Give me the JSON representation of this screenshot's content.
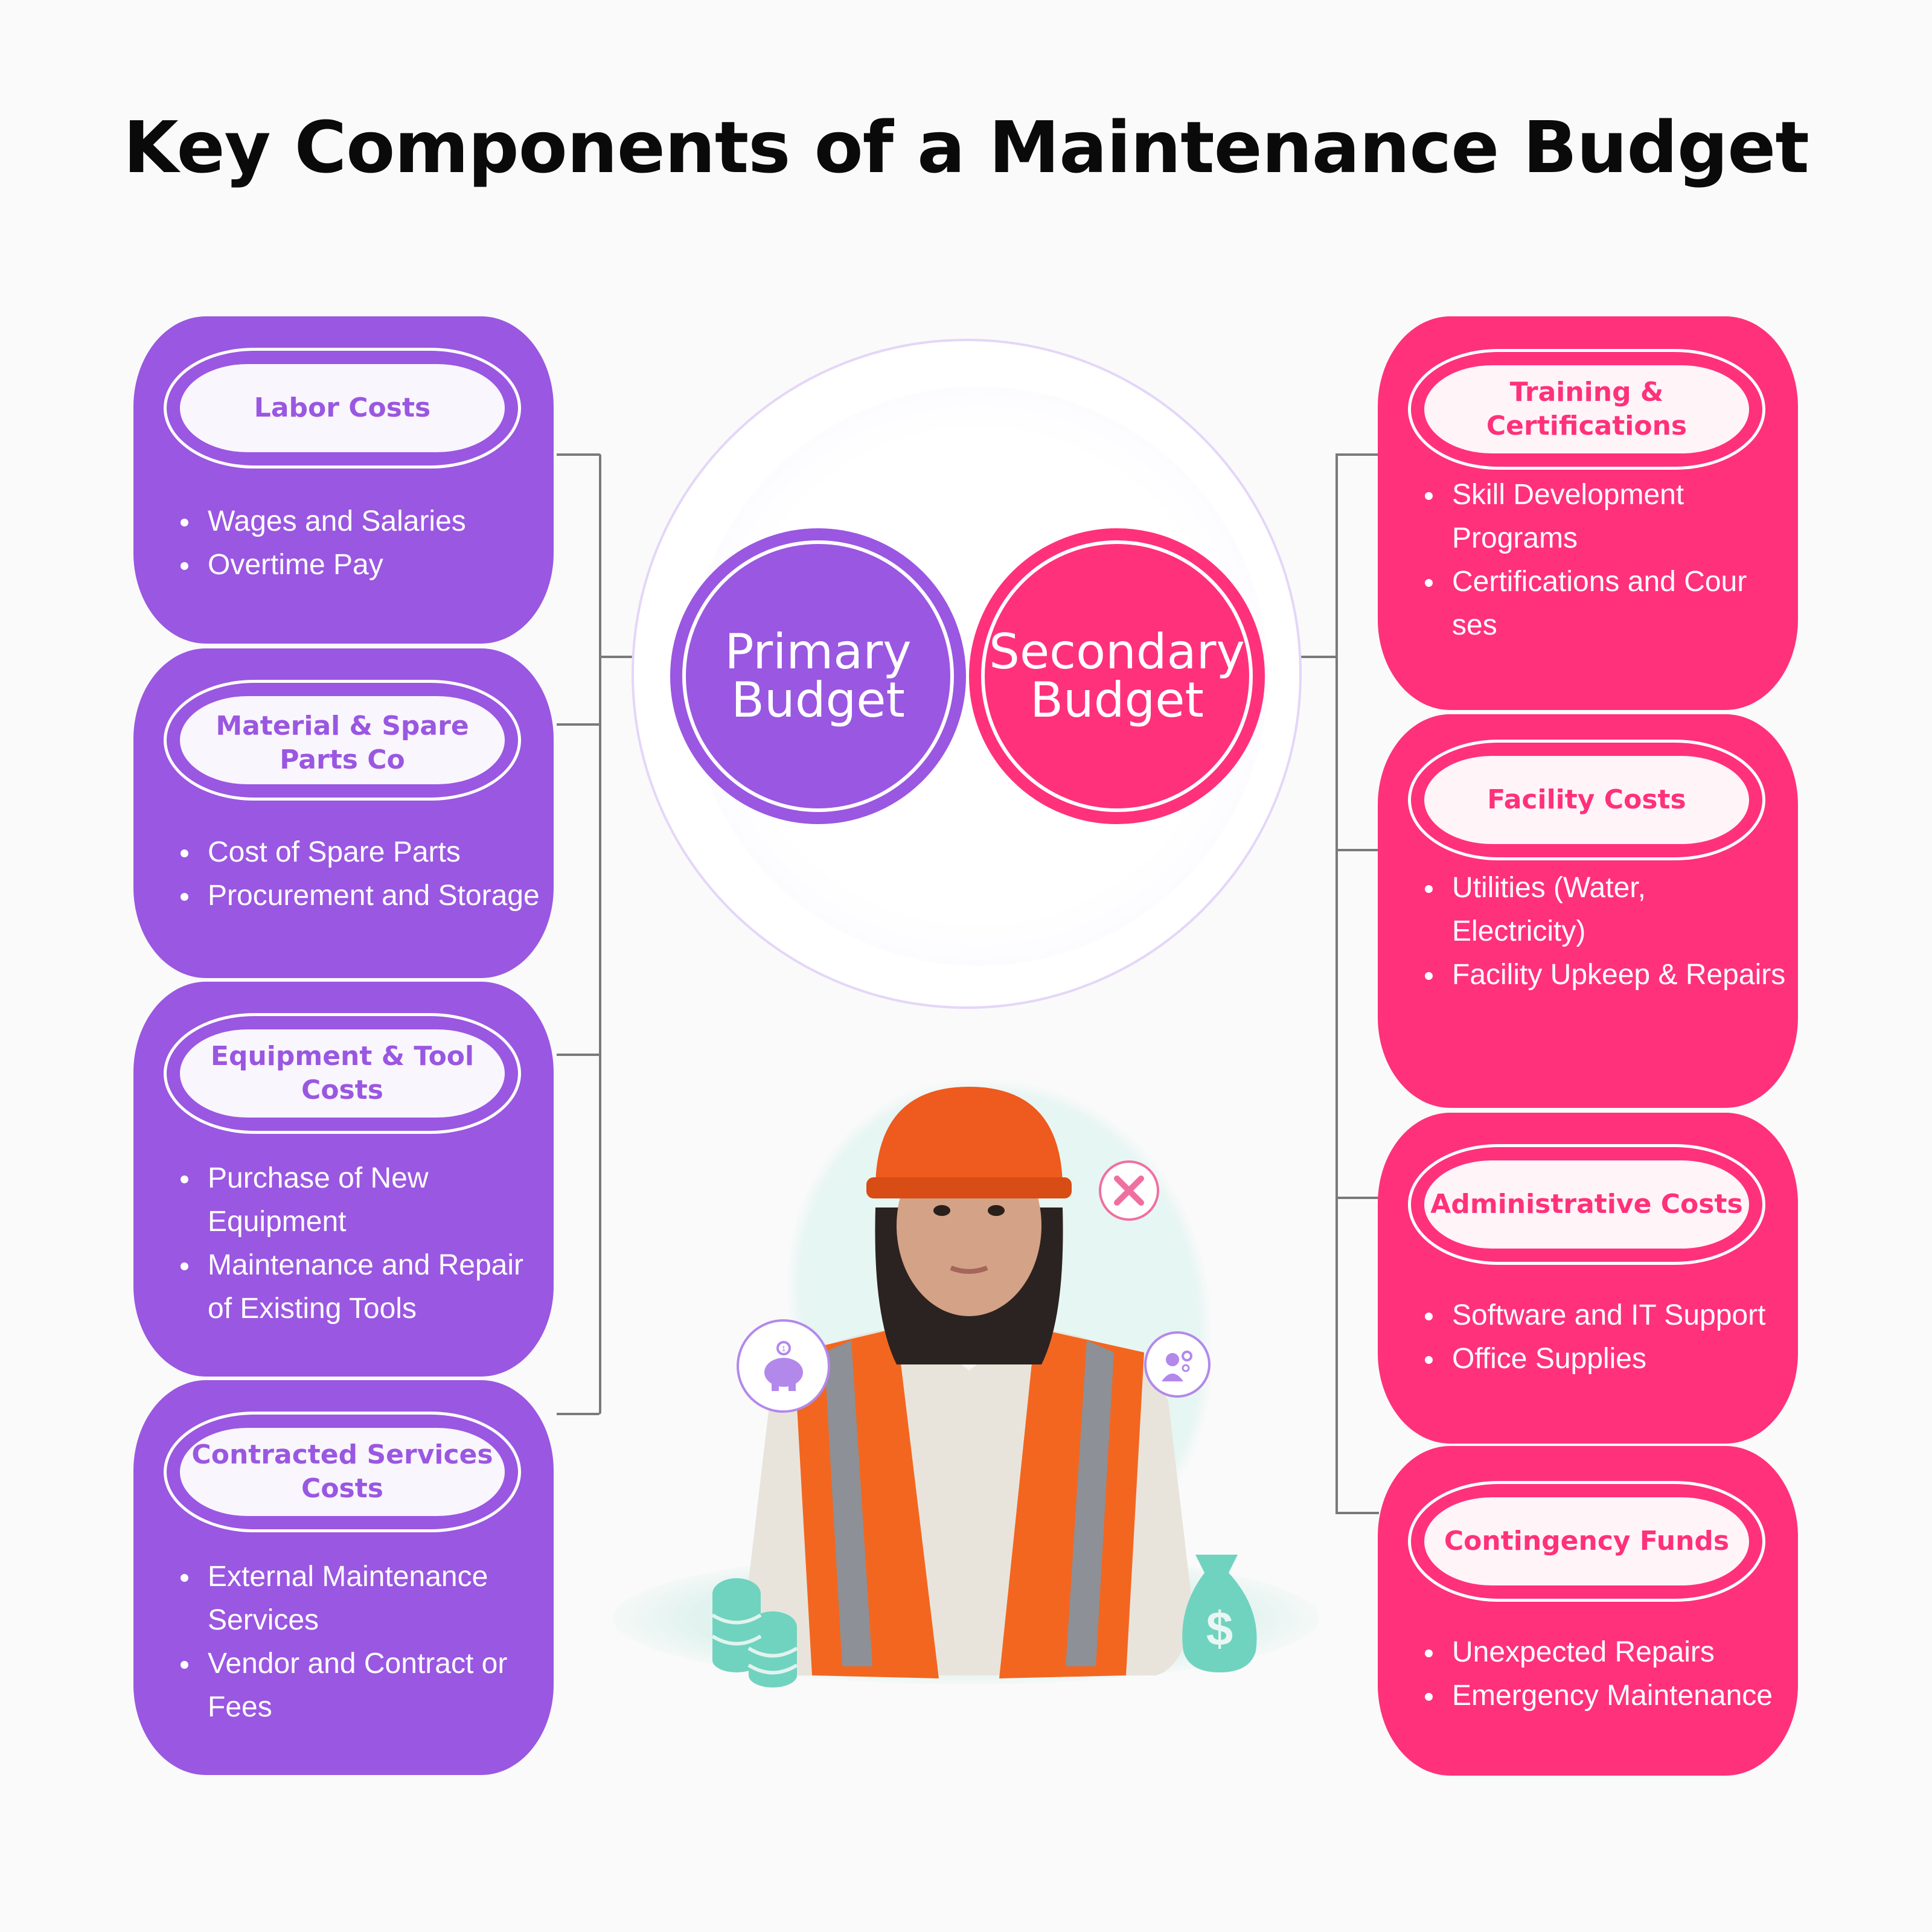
{
  "title": "Key Components of a Maintenance Budget",
  "colors": {
    "primary": "#9a57e1",
    "secondary": "#ff317a",
    "accent_teal": "#6fd3bf",
    "hardhat_orange": "#ef5a1e"
  },
  "center": {
    "primary_line1": "Primary",
    "primary_line2": "Budget",
    "secondary_line1": "Secondary",
    "secondary_line2": "Budget"
  },
  "primary_components": [
    {
      "heading": "Labor Costs",
      "items": [
        "Wages and Salaries",
        "Overtime Pay"
      ]
    },
    {
      "heading": "Material & Spare Parts Co",
      "items": [
        "Cost of Spare Parts",
        "Procurement and Storage"
      ]
    },
    {
      "heading": "Equipment & Tool Costs",
      "items": [
        "Purchase of New Equipment",
        "Maintenance and Repair of Existing Tools"
      ]
    },
    {
      "heading": "Contracted Services Costs",
      "items": [
        "External Maintenance Services",
        "Vendor and Contract or  Fees"
      ]
    }
  ],
  "secondary_components": [
    {
      "heading": "Training & Certifications",
      "items": [
        "Skill Development Programs",
        "Certifications and Cour ses"
      ]
    },
    {
      "heading": "Facility Costs",
      "items": [
        "Utilities (Water, Electricity)",
        "Facility Upkeep & Repairs"
      ]
    },
    {
      "heading": "Administrative Costs",
      "items": [
        "Software and IT Support",
        "Office Supplies"
      ]
    },
    {
      "heading": "Contingency Funds",
      "items": [
        "Unexpected Repairs",
        "Emergency Maintenance"
      ]
    }
  ],
  "illustration": {
    "subject": "worker-in-hardhat-and-safety-vest",
    "icons": [
      "tools-icon",
      "piggy-bank-icon",
      "engineer-gears-icon",
      "coin-stack-icon",
      "money-bag-icon"
    ],
    "coin_label": "1",
    "money_symbol": "$"
  }
}
